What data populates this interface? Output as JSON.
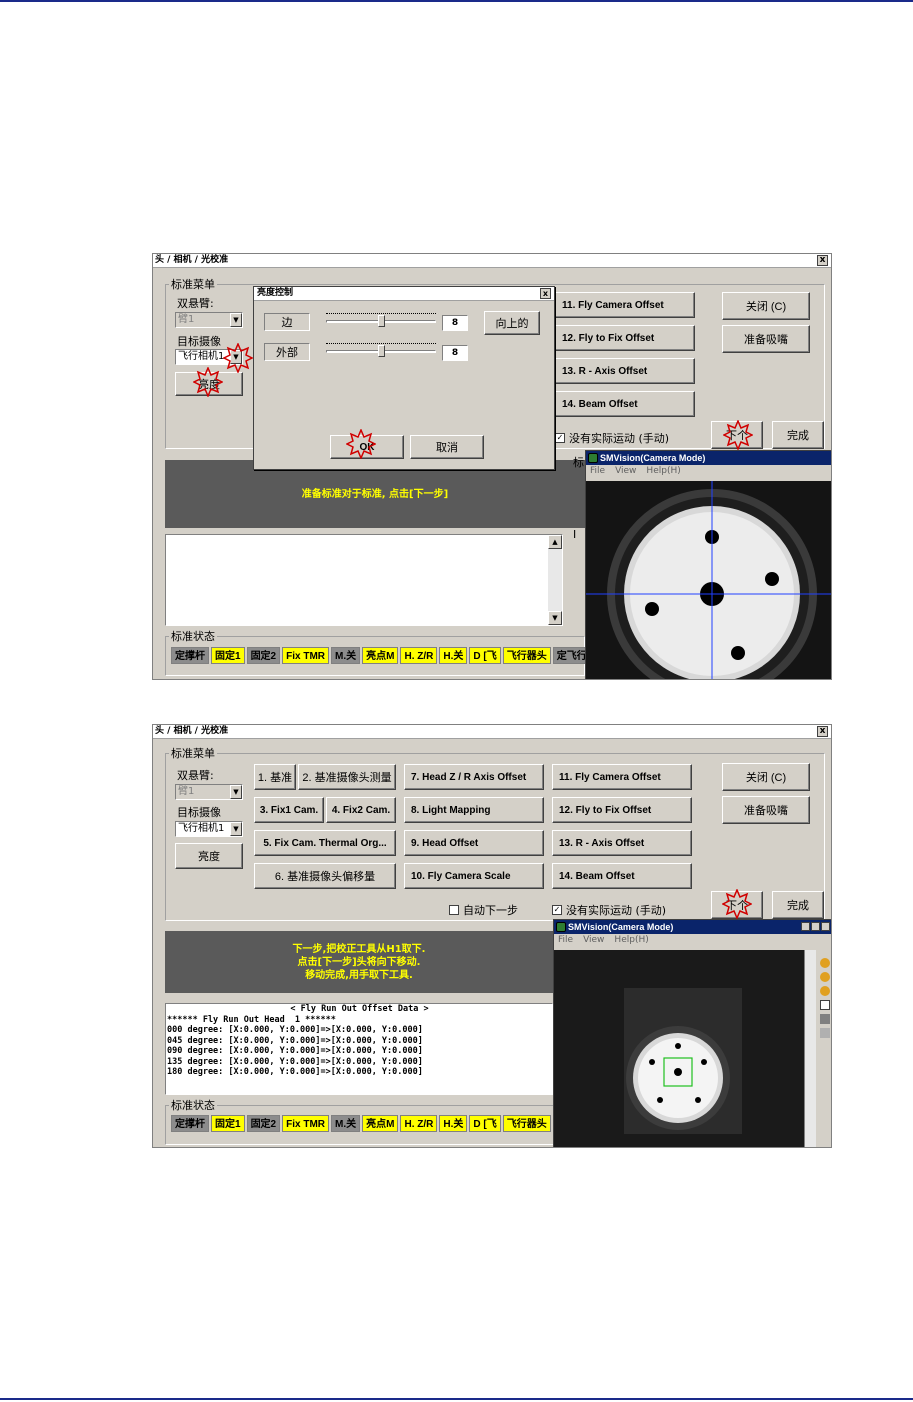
{
  "colors": {
    "status_yellow": "#ffff00",
    "status_gray": "#8c8c8c",
    "message_bg": "#5a5a5a",
    "message_text": "#ffff00",
    "camera_title_bg": "#0a246a",
    "highlight_marker": "#d00000",
    "crosshair": "#2040ff",
    "box_marker": "#20c020"
  },
  "screen1": {
    "window_title": "头 / 相机 / 光校准",
    "close_glyph": "x",
    "group_calib_menu": "标准菜单",
    "arm_label": "双悬臂:",
    "arm_value": "臂1",
    "target_camera_label": "目标摄像",
    "target_camera_value": "飞行相机1",
    "brightness_btn": "亮度",
    "buttons_right": [
      "11. Fly Camera Offset",
      "12. Fly to Fix Offset",
      "13. R - Axis Offset",
      "14. Beam Offset"
    ],
    "close_btn": "关闭 (C)",
    "prepare_nozzle_btn": "准备吸嘴",
    "no_motion_chk": "没有实际运动 (手动)",
    "next_btn": "下个",
    "finish_btn": "完成",
    "message": "准备标准对于标准, 点击[下一步]",
    "status_group": "标准状态",
    "status": [
      {
        "t": "定撑杆",
        "c": "g"
      },
      {
        "t": "固定1",
        "c": "y"
      },
      {
        "t": "固定2",
        "c": "g"
      },
      {
        "t": "Fix TMR",
        "c": "y"
      },
      {
        "t": "M.关",
        "c": "g"
      },
      {
        "t": "亮点M",
        "c": "y"
      },
      {
        "t": "H. Z/R",
        "c": "y"
      },
      {
        "t": "H.关",
        "c": "y"
      },
      {
        "t": "D [飞",
        "c": "y"
      },
      {
        "t": "飞行器头",
        "c": "y"
      },
      {
        "t": "定飞行",
        "c": "g"
      }
    ],
    "dialog": {
      "title": "亮度控制",
      "edge_label": "边",
      "outer_label": "外部",
      "edge_value": "8",
      "outer_value": "8",
      "up_btn": "向上的",
      "ok_btn": "OK",
      "cancel_btn": "取消"
    },
    "camera": {
      "title": "SMVision(Camera Mode)",
      "menu": [
        "File",
        "View",
        "Help(H)"
      ]
    },
    "partial_labels": [
      "标",
      "I"
    ]
  },
  "screen2": {
    "window_title": "头 / 相机 / 光校准",
    "close_glyph": "x",
    "group_calib_menu": "标准菜单",
    "arm_label": "双悬臂:",
    "arm_value": "臂1",
    "target_camera_label": "目标摄像",
    "target_camera_value": "飞行相机1",
    "brightness_btn": "亮度",
    "col1": [
      "1. 基准",
      "2. 基准摄像头测量"
    ],
    "col1b": [
      "3. Fix1 Cam.",
      "4. Fix2 Cam."
    ],
    "col1c": "5. Fix Cam. Thermal Org...",
    "col1d": "6. 基准摄像头偏移量",
    "col2": [
      "7. Head Z / R Axis Offset",
      "8. Light Mapping",
      "9. Head Offset",
      "10. Fly Camera Scale"
    ],
    "col3": [
      "11. Fly Camera Offset",
      "12. Fly to Fix Offset",
      "13. R - Axis Offset",
      "14. Beam Offset"
    ],
    "close_btn": "关闭 (C)",
    "prepare_nozzle_btn": "准备吸嘴",
    "auto_next_chk": "自动下一步",
    "no_motion_chk": "没有实际运动 (手动)",
    "next_btn": "下个",
    "finish_btn": "完成",
    "message_lines": [
      "下一步,把校正工具从H1取下.",
      "点击[下一步]头将向下移动.",
      "移动完成,用手取下工具."
    ],
    "data_title": "< Fly Run Out Offset Data >",
    "data_lines": [
      "****** Fly Run Out Head  1 ******",
      "000 degree: [X:0.000, Y:0.000]=>[X:0.000, Y:0.000]",
      "045 degree: [X:0.000, Y:0.000]=>[X:0.000, Y:0.000]",
      "090 degree: [X:0.000, Y:0.000]=>[X:0.000, Y:0.000]",
      "135 degree: [X:0.000, Y:0.000]=>[X:0.000, Y:0.000]",
      "180 degree: [X:0.000, Y:0.000]=>[X:0.000, Y:0.000]"
    ],
    "status_group": "标准状态",
    "status": [
      {
        "t": "定撑杆",
        "c": "g"
      },
      {
        "t": "固定1",
        "c": "y"
      },
      {
        "t": "固定2",
        "c": "g"
      },
      {
        "t": "Fix TMR",
        "c": "y"
      },
      {
        "t": "M.关",
        "c": "g"
      },
      {
        "t": "亮点M",
        "c": "y"
      },
      {
        "t": "H. Z/R",
        "c": "y"
      },
      {
        "t": "H.关",
        "c": "y"
      },
      {
        "t": "D [飞",
        "c": "y"
      },
      {
        "t": "飞行器头",
        "c": "y"
      }
    ],
    "camera": {
      "title": "SMVision(Camera Mode)",
      "menu": [
        "File",
        "View",
        "Help(H)"
      ]
    }
  }
}
